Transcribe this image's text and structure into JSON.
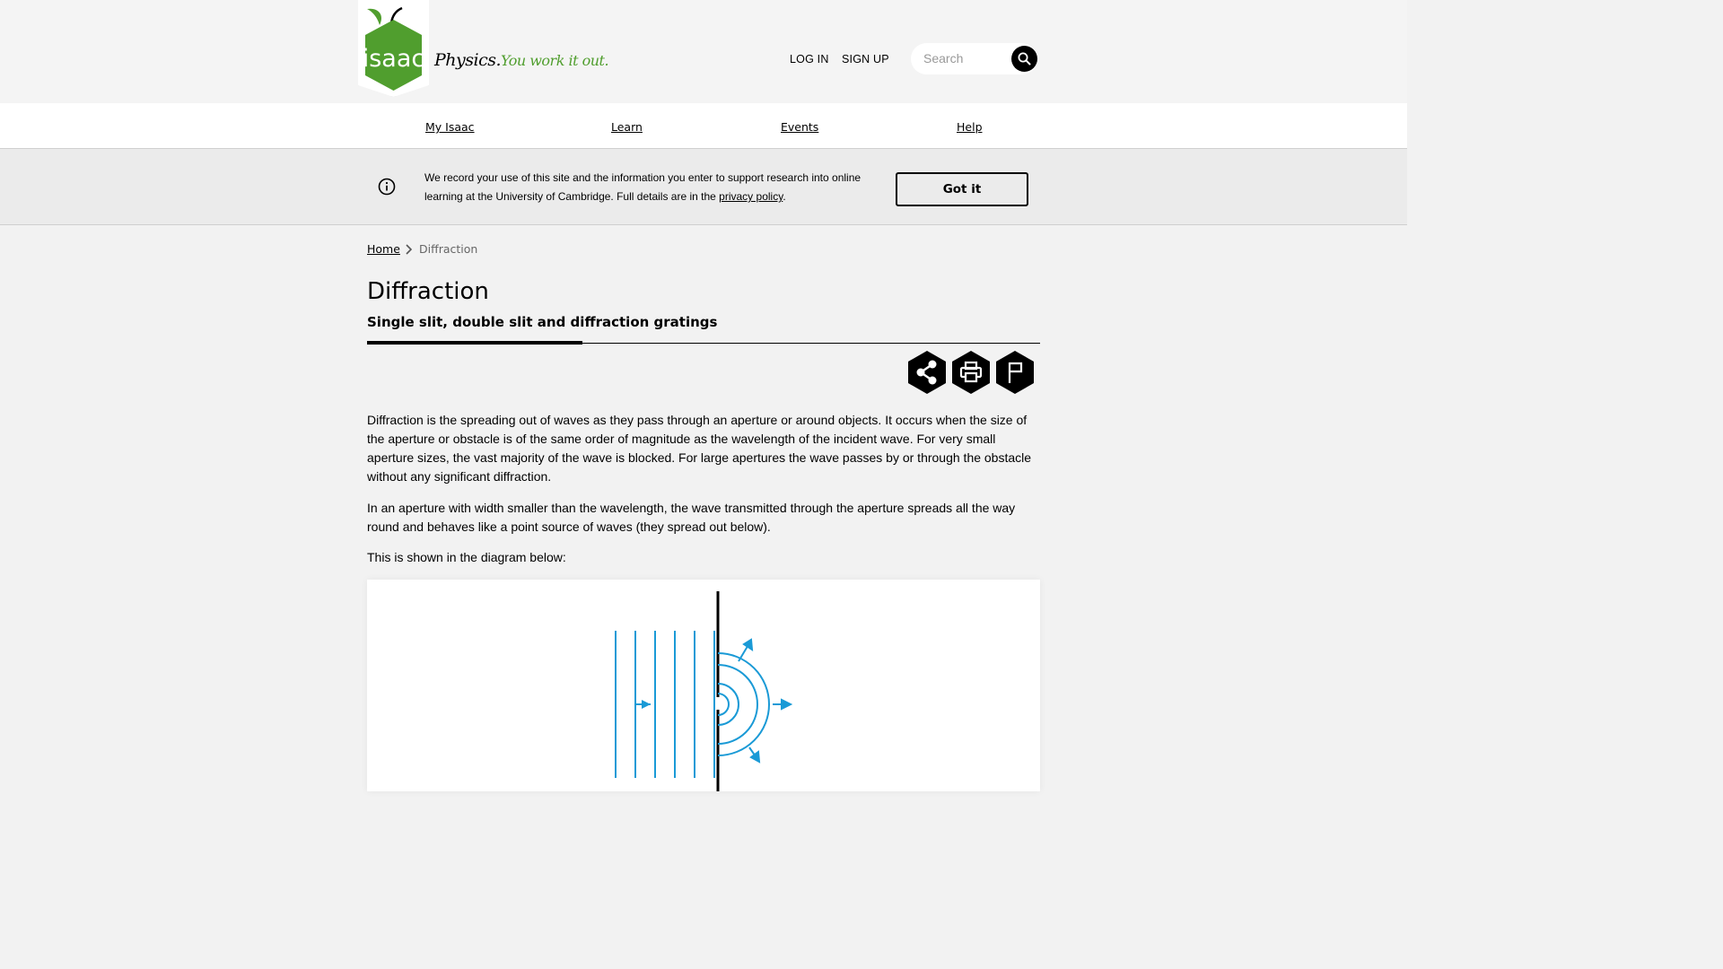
{
  "header": {
    "logo_text": "isaac",
    "tagline_part1": "Physics.",
    "tagline_part2": "You work it out.",
    "login_label": "LOG IN",
    "signup_label": "SIGN UP",
    "search_placeholder": "Search"
  },
  "nav": {
    "items": [
      {
        "label": "My Isaac"
      },
      {
        "label": "Learn"
      },
      {
        "label": "Events"
      },
      {
        "label": "Help"
      }
    ]
  },
  "cookie_banner": {
    "text": "We record your use of this site and the information you enter to support research into online learning at the University of Cambridge. Full details are in the ",
    "link_label": "privacy policy",
    "text_end": ".",
    "button_label": "Got it"
  },
  "breadcrumb": {
    "home_label": "Home",
    "current_label": "Diffraction"
  },
  "page": {
    "title": "Diffraction",
    "subtitle": "Single slit, double slit and diffraction gratings",
    "paragraphs": [
      "Diffraction is the spreading out of waves as they pass through an aperture or around objects. It occurs when the size of the aperture or obstacle is of the same order of magnitude as the wavelength of the incident wave. For very small aperture sizes, the vast majority of the wave is blocked. For large apertures the wave passes by or through the obstacle without any significant diffraction.",
      "In an aperture with width smaller than the wavelength, the wave transmitted through the aperture spreads all the way round and behaves like a point source of waves (they spread out below).",
      "This is shown in the diagram below:"
    ]
  },
  "actions": {
    "share_icon": "share-icon",
    "print_icon": "print-icon",
    "flag_icon": "flag-icon"
  },
  "colors": {
    "brand_green": "#509e2e",
    "wave_blue": "#1a9ad6",
    "background": "#f2f2f2"
  }
}
